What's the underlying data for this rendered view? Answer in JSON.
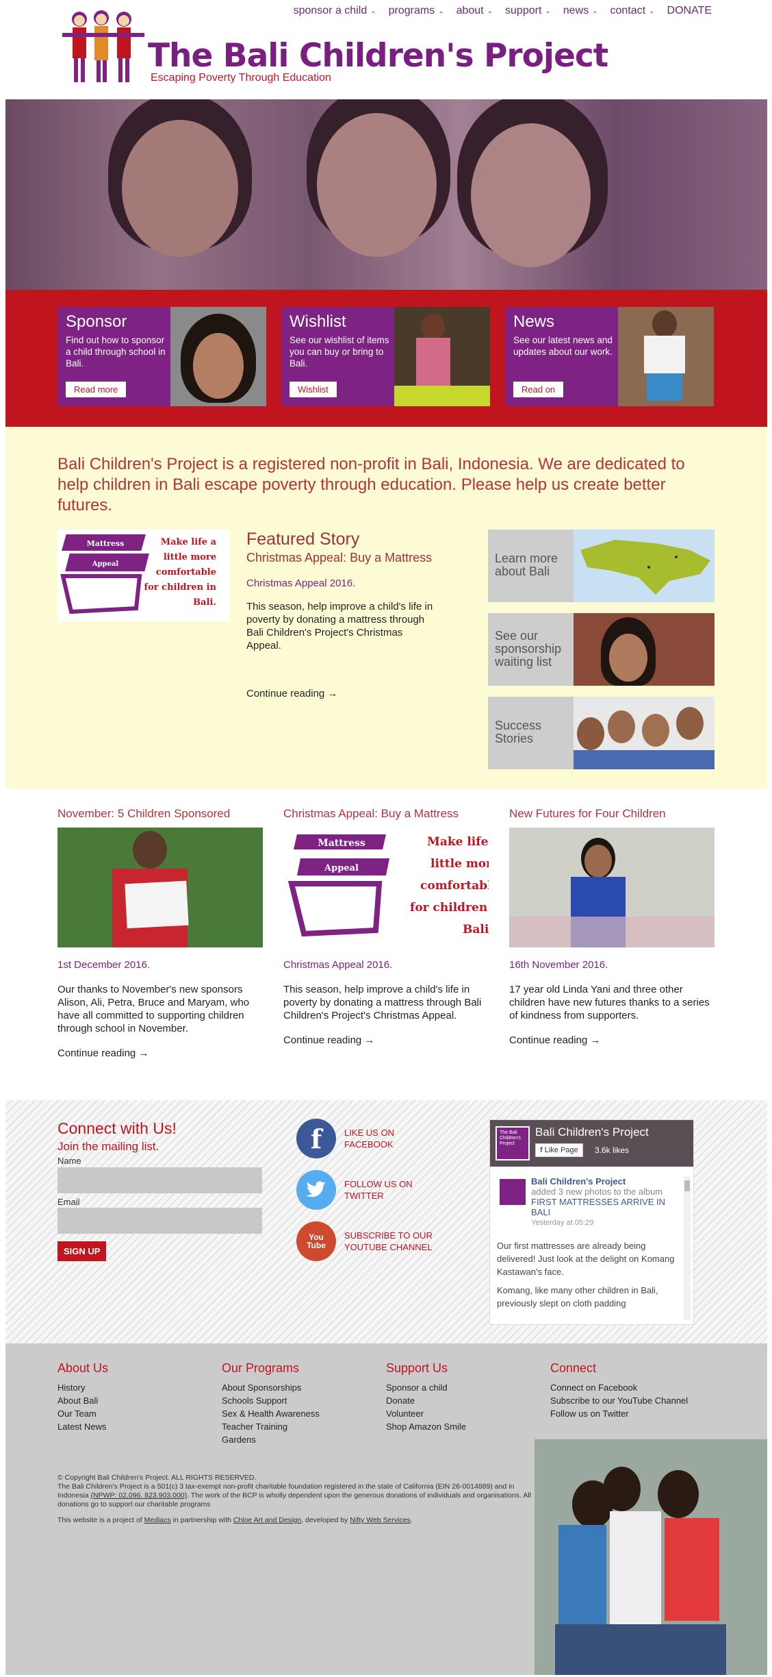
{
  "header": {
    "title": "The Bali Children's Project",
    "tagline": "Escaping Poverty Through Education"
  },
  "nav": [
    {
      "label": "sponsor a child",
      "dropdown": true
    },
    {
      "label": "programs",
      "dropdown": true
    },
    {
      "label": "about",
      "dropdown": true
    },
    {
      "label": "support",
      "dropdown": true
    },
    {
      "label": "news",
      "dropdown": true
    },
    {
      "label": "contact",
      "dropdown": true
    },
    {
      "label": "DONATE",
      "dropdown": false
    }
  ],
  "cards": [
    {
      "title": "Sponsor",
      "text": "Find out how to sponsor a child through school in Bali.",
      "button": "Read more"
    },
    {
      "title": "Wishlist",
      "text": "See our wishlist of items you can buy or bring to Bali.",
      "button": "Wishlist"
    },
    {
      "title": "News",
      "text": "See our latest news and updates about our work.",
      "button": "Read on"
    }
  ],
  "mission": "Bali Children's Project is a registered non-profit in Bali, Indonesia. We are dedicated to help children in Bali escape poverty through education. Please help us create better futures.",
  "mattress_graphic": {
    "lines": [
      "Make life a",
      "little more",
      "comfortable",
      "for children in",
      "Bali."
    ],
    "label1": "Mattress",
    "label2": "Appeal"
  },
  "featured": {
    "heading": "Featured Story",
    "subheading": "Christmas Appeal: Buy a Mattress",
    "date": "Christmas Appeal 2016.",
    "text": "This season, help improve a child's life in poverty by donating a mattress through Bali Children's Project's Christmas Appeal.",
    "more": "Continue reading →"
  },
  "side_links": [
    {
      "label": "Learn more about Bali"
    },
    {
      "label": "See our sponsorship waiting list"
    },
    {
      "label": "Success Stories"
    }
  ],
  "news": [
    {
      "title": "November: 5 Children Sponsored",
      "date": "1st December 2016.",
      "text": "Our thanks to November's new sponsors Alison, Ali, Petra, Bruce and Maryam, who have all committed to supporting children through school in November.",
      "more": "Continue reading →"
    },
    {
      "title": "Christmas Appeal: Buy a Mattress",
      "date": "Christmas Appeal 2016.",
      "text": "This season, help improve a child's life in poverty by donating a mattress through Bali Children's Project's Christmas Appeal.",
      "more": "Continue reading →"
    },
    {
      "title": "New Futures for Four Children",
      "date": "16th November 2016.",
      "text": "17 year old Linda Yani and three other children have new futures thanks to a series of kindness from supporters.",
      "more": "Continue reading →"
    }
  ],
  "connect": {
    "heading": "Connect with Us!",
    "subheading": "Join the mailing list.",
    "name_label": "Name",
    "email_label": "Email",
    "signup": "SIGN UP"
  },
  "social": [
    {
      "label": "LIKE US ON FACEBOOK",
      "icon": "facebook-icon",
      "color": "#3b5998"
    },
    {
      "label": "FOLLOW US ON TWITTER",
      "icon": "twitter-icon",
      "color": "#55acee"
    },
    {
      "label": "SUBSCRIBE TO OUR YOUTUBE CHANNEL",
      "icon": "youtube-icon",
      "color": "#cd201f"
    }
  ],
  "facebook_widget": {
    "page_title": "Bali Children's Project",
    "like": "Like Page",
    "likes": "3.6k likes",
    "logo_text": "The Bali Children's Project",
    "poster": "Bali Children's Project",
    "action": "added 3 new photos to the album",
    "album": "FIRST MATTRESSES ARRIVE IN BALI",
    "time": "Yesterday at 05:29",
    "body1": "Our first mattresses are already being delivered! Just look at the delight on Komang Kastawan's face.",
    "body2": "Komang, like many other children in Bali, previously slept on cloth padding"
  },
  "footer": {
    "columns": [
      {
        "heading": "About Us",
        "links": [
          "History",
          "About Bali",
          "Our Team",
          "Latest News"
        ]
      },
      {
        "heading": "Our Programs",
        "links": [
          "About Sponsorships",
          "Schools Support",
          "Sex & Health Awareness",
          "Teacher Training",
          "Gardens"
        ]
      },
      {
        "heading": "Support Us",
        "links": [
          "Sponsor a child",
          "Donate",
          "Volunteer",
          "Shop Amazon Smile"
        ]
      },
      {
        "heading": "Connect",
        "links": [
          "Connect on Facebook",
          "Subscribe to our YouTube Channel",
          "Follow us on Twitter"
        ]
      }
    ],
    "copyright": "© Copyright Bali Children's Project. ALL RIGHTS RESERVED.",
    "legal_a": "The Bali Children's Project is a 501(c) 3 tax-exempt non-profit charitable foundation registered in the state of California (EIN 26-0014889) and in Indonesia",
    "legal_npwp": "(NPWP: 02.096. 823.903.000)",
    "legal_b": ". The work of the BCP is wholly dependent upon the generous donations of individuals and organisations. All donations go to support our charitable programs",
    "credit_a": "This website is a project of",
    "credit_mediacs": "Mediacs",
    "credit_b": "in partnership with",
    "credit_chloe": "Chloe Art and Design",
    "credit_c": ", developed by",
    "credit_nifty": "Nifty Web Services",
    "credit_d": "."
  },
  "colors": {
    "purple": "#7e2284",
    "red": "#c0141f",
    "cream": "#fdfbd3"
  }
}
